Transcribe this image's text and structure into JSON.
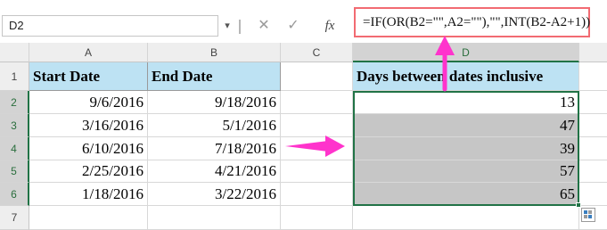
{
  "name_box": {
    "value": "D2",
    "dropdown_icon": "chevron-down-icon"
  },
  "formula_bar": {
    "cancel_icon": "✕",
    "enter_icon": "✓",
    "fx_label": "fx",
    "formula": "=IF(OR(B2=\"\",A2=\"\"),\"\",INT(B2-A2+1))"
  },
  "columns": [
    "A",
    "B",
    "C",
    "D"
  ],
  "rows": [
    "1",
    "2",
    "3",
    "4",
    "5",
    "6",
    "7"
  ],
  "headers": {
    "start_date": "Start Date",
    "end_date": "End Date",
    "days_between": "Days between dates inclusive"
  },
  "table": [
    {
      "start": "9/6/2016",
      "end": "9/18/2016",
      "days": "13"
    },
    {
      "start": "3/16/2016",
      "end": "5/1/2016",
      "days": "47"
    },
    {
      "start": "6/10/2016",
      "end": "7/18/2016",
      "days": "39"
    },
    {
      "start": "2/25/2016",
      "end": "4/21/2016",
      "days": "57"
    },
    {
      "start": "1/18/2016",
      "end": "3/22/2016",
      "days": "65"
    }
  ],
  "colors": {
    "accent_arrow": "#ff33cc",
    "header_fill": "#bde2f3",
    "selection_border": "#217346",
    "formula_highlight": "#f26b72",
    "selection_fill": "#c6c6c6"
  },
  "icons": {
    "quick_analysis": "quick-analysis-icon"
  }
}
